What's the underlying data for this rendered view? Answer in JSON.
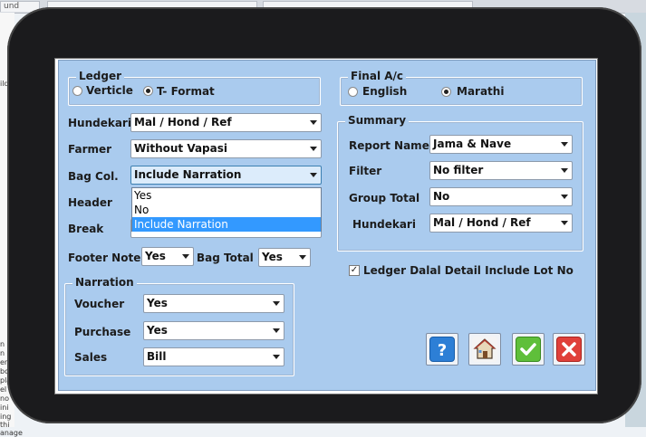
{
  "background": {
    "tab_label": "und",
    "left_fragments": [
      "ild",
      "n ul",
      "n",
      "en",
      "boo",
      "pla",
      "el",
      "no",
      "ini",
      "ing",
      "thi",
      "anage"
    ]
  },
  "dialog": {
    "ledger": {
      "legend": "Ledger",
      "options": [
        "Verticle",
        "T- Format"
      ],
      "selected": "T- Format"
    },
    "final_ac": {
      "legend": "Final A/c",
      "options": [
        "English",
        "Marathi"
      ],
      "selected": "Marathi"
    },
    "fields": {
      "hundekari": {
        "label": "Hundekari",
        "value": "Mal / Hond / Ref"
      },
      "farmer": {
        "label": "Farmer",
        "value": "Without Vapasi"
      },
      "bag_col": {
        "label": "Bag Col.",
        "value": "Include Narration"
      },
      "header": {
        "label": "Header"
      },
      "break": {
        "label": "Break"
      },
      "footer_note": {
        "label": "Footer Note",
        "value": "Yes"
      },
      "bag_total": {
        "label": "Bag Total",
        "value": "Yes"
      }
    },
    "bag_col_dropdown": {
      "options": [
        "Yes",
        "No",
        "Include Narration"
      ],
      "highlighted": "Include Narration"
    },
    "narration": {
      "legend": "Narration",
      "voucher": {
        "label": "Voucher",
        "value": "Yes"
      },
      "purchase": {
        "label": "Purchase",
        "value": "Yes"
      },
      "sales": {
        "label": "Sales",
        "value": "Bill"
      }
    },
    "summary": {
      "legend": "Summary",
      "report_name": {
        "label": "Report Name",
        "value": "Jama & Nave"
      },
      "filter": {
        "label": "Filter",
        "value": "No filter"
      },
      "group_total": {
        "label": "Group Total",
        "value": "No"
      },
      "hundekari": {
        "label": "Hundekari",
        "value": "Mal / Hond / Ref"
      }
    },
    "ledger_dalal": {
      "label": "Ledger Dalal Detail Include Lot No",
      "checked": true
    },
    "buttons": [
      "help",
      "home",
      "ok",
      "cancel"
    ]
  },
  "colors": {
    "dialog_bg": "#aacbee",
    "highlight": "#3399ff",
    "ok_green": "#5fbf3a",
    "cancel_red": "#e0403a",
    "help_blue": "#2d7fd6"
  }
}
